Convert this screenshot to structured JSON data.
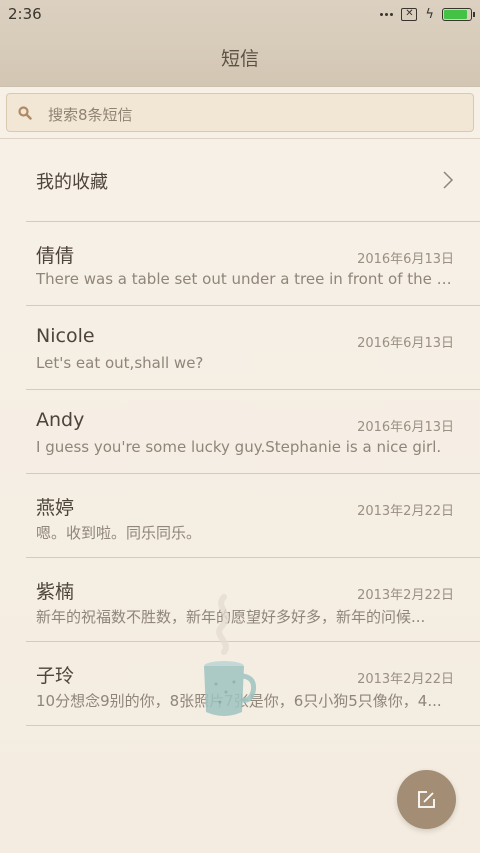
{
  "status_bar": {
    "time": "2:36",
    "battery_level": 0.9,
    "battery_color": "#43c246"
  },
  "header": {
    "title": "短信"
  },
  "search": {
    "placeholder": "搜索8条短信",
    "icon": "search-icon"
  },
  "favorites": {
    "label": "我的收藏",
    "icon": "chevron-right-icon"
  },
  "conversations": [
    {
      "name": "倩倩",
      "date": "2016年6月13日",
      "preview": "There was a table set out under a tree in front of the ho..."
    },
    {
      "name": "Nicole",
      "date": "2016年6月13日",
      "preview": "Let's eat out,shall we?"
    },
    {
      "name": "Andy",
      "date": "2016年6月13日",
      "preview": "I guess you're some lucky guy.Stephanie is a nice girl."
    },
    {
      "name": "燕婷",
      "date": "2013年2月22日",
      "preview": "嗯。收到啦。同乐同乐。"
    },
    {
      "name": "紫楠",
      "date": "2013年2月22日",
      "preview": "新年的祝福数不胜数，新年的愿望好多好多，新年的问候..."
    },
    {
      "name": "子玲",
      "date": "2013年2月22日",
      "preview": "10分想念9别的你，8张照片7张是你，6只小狗5只像你，4..."
    }
  ],
  "fab": {
    "icon": "compose-icon",
    "color": "#a38d75"
  },
  "colors": {
    "background": "#f6efe4",
    "header": "#d8ccbb",
    "accent": "#a38d75"
  }
}
